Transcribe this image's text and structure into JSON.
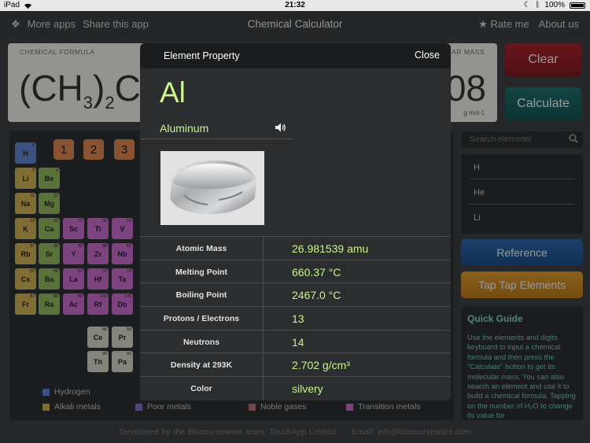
{
  "status_bar": {
    "carrier": "iPad",
    "time": "21:32",
    "battery": "100%"
  },
  "nav": {
    "more_apps": "More apps",
    "share": "Share this app",
    "title": "Chemical Calculator",
    "rate": "Rate me",
    "about": "About us"
  },
  "formula": {
    "label": "CHEMICAL FORMULA",
    "text_prefix": "(CH",
    "subscript_1": "3",
    "text_middle": ")",
    "subscript_2": "2",
    "text_suffix": "C",
    "molar_label": "MOLAR MASS",
    "molar_value": "08",
    "molar_unit": "g mol-1"
  },
  "buttons": {
    "clear": "Clear",
    "calculate": "Calculate",
    "reference": "Reference",
    "tap_tap": "Tap Tap Elements"
  },
  "keypad_digits": [
    "1",
    "2",
    "3"
  ],
  "periodic_table": [
    {
      "n": "1",
      "s": "H",
      "t": "h"
    },
    {
      "n": "3",
      "s": "Li",
      "t": "alk"
    },
    {
      "n": "4",
      "s": "Be",
      "t": "ae"
    },
    {
      "n": "11",
      "s": "Na",
      "t": "alk"
    },
    {
      "n": "12",
      "s": "Mg",
      "t": "ae"
    },
    {
      "n": "19",
      "s": "K",
      "t": "alk"
    },
    {
      "n": "20",
      "s": "Ca",
      "t": "ae"
    },
    {
      "n": "21",
      "s": "Sc",
      "t": "tr"
    },
    {
      "n": "22",
      "s": "Ti",
      "t": "tr"
    },
    {
      "n": "23",
      "s": "V",
      "t": "tr"
    },
    {
      "n": "37",
      "s": "Rb",
      "t": "alk"
    },
    {
      "n": "38",
      "s": "Sr",
      "t": "ae"
    },
    {
      "n": "39",
      "s": "Y",
      "t": "tr"
    },
    {
      "n": "40",
      "s": "Zr",
      "t": "tr"
    },
    {
      "n": "41",
      "s": "Nb",
      "t": "tr"
    },
    {
      "n": "55",
      "s": "Cs",
      "t": "alk"
    },
    {
      "n": "56",
      "s": "Ba",
      "t": "ae"
    },
    {
      "n": "57",
      "s": "La",
      "t": "tr"
    },
    {
      "n": "72",
      "s": "Hf",
      "t": "tr"
    },
    {
      "n": "73",
      "s": "Ta",
      "t": "tr"
    },
    {
      "n": "87",
      "s": "Fr",
      "t": "alk"
    },
    {
      "n": "88",
      "s": "Ra",
      "t": "ae"
    },
    {
      "n": "89",
      "s": "Ac",
      "t": "tr"
    },
    {
      "n": "104",
      "s": "Rf",
      "t": "tr"
    },
    {
      "n": "105",
      "s": "Db",
      "t": "tr"
    },
    {
      "n": "58",
      "s": "Ce",
      "t": "ln"
    },
    {
      "n": "59",
      "s": "Pr",
      "t": "ln"
    },
    {
      "n": "90",
      "s": "Th",
      "t": "ln"
    },
    {
      "n": "91",
      "s": "Pa",
      "t": "ln"
    }
  ],
  "legend": {
    "hydrogen": "Hydrogen",
    "alkali": "Alkali metals",
    "poor": "Poor metals",
    "noble": "Noble gases",
    "transition": "Transition metals"
  },
  "colors": {
    "hydrogen": "#5d7fc7",
    "alkali": "#c9ab52",
    "poor": "#7f6fc7",
    "noble": "#c06a6a",
    "transition": "#c369c9",
    "accent_green": "#c9f58c"
  },
  "search": {
    "placeholder": "Search elements",
    "results": [
      "H",
      "He",
      "Li"
    ]
  },
  "guide": {
    "title": "Quick Guide",
    "text": "Use the elements and digits keyboard to input a chemical formula and then press the \"Calculate\" button to get its molecular mass. You can also search an element and use it to build a chemical formula. Tapping on the number of H₂O to change its value for"
  },
  "footer": {
    "credit": "Developed by the Biocourseware team, TouchApp Limited",
    "email": "Email: info@biocourseware.com"
  },
  "modal": {
    "title": "Element Property",
    "close": "Close",
    "symbol": "Al",
    "name": "Aluminum",
    "properties": [
      {
        "label": "Atomic Mass",
        "value": "26.981539 amu"
      },
      {
        "label": "Melting Point",
        "value": "660.37 °C"
      },
      {
        "label": "Boiling Point",
        "value": "2467.0 °C"
      },
      {
        "label": "Protons / Electrons",
        "value": "13"
      },
      {
        "label": "Neutrons",
        "value": "14"
      },
      {
        "label": "Density at 293K",
        "value": "2.702 g/cm³"
      },
      {
        "label": "Color",
        "value": "silvery"
      }
    ]
  }
}
